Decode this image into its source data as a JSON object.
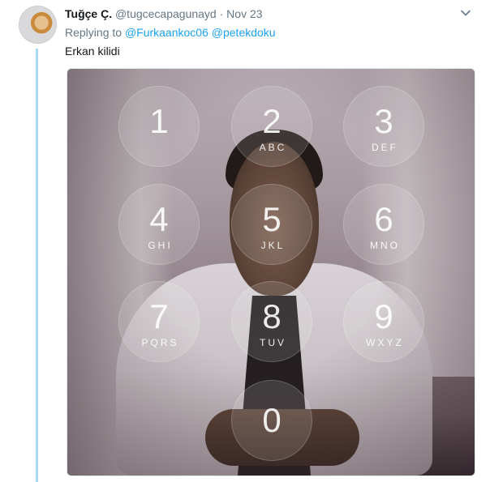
{
  "tweet": {
    "author_name": "Tuğçe Ç.",
    "handle": "@tugcecapagunayd",
    "separator": " · ",
    "date": "Nov 23",
    "replying_prefix": "Replying to ",
    "mentions": [
      "@Furkaankoc06",
      "@petekdoku"
    ],
    "text": "Erkan kilidi",
    "menu_icon": "chevron-down-icon"
  },
  "keypad": [
    {
      "digit": "1",
      "letters": ""
    },
    {
      "digit": "2",
      "letters": "ABC"
    },
    {
      "digit": "3",
      "letters": "DEF"
    },
    {
      "digit": "4",
      "letters": "GHI"
    },
    {
      "digit": "5",
      "letters": "JKL"
    },
    {
      "digit": "6",
      "letters": "MNO"
    },
    {
      "digit": "7",
      "letters": "PQRS"
    },
    {
      "digit": "8",
      "letters": "TUV"
    },
    {
      "digit": "9",
      "letters": "WXYZ"
    },
    {
      "digit": "0",
      "letters": ""
    }
  ],
  "colors": {
    "link": "#1da1f2",
    "muted": "#657786",
    "thread_line": "#a8d8f7"
  }
}
